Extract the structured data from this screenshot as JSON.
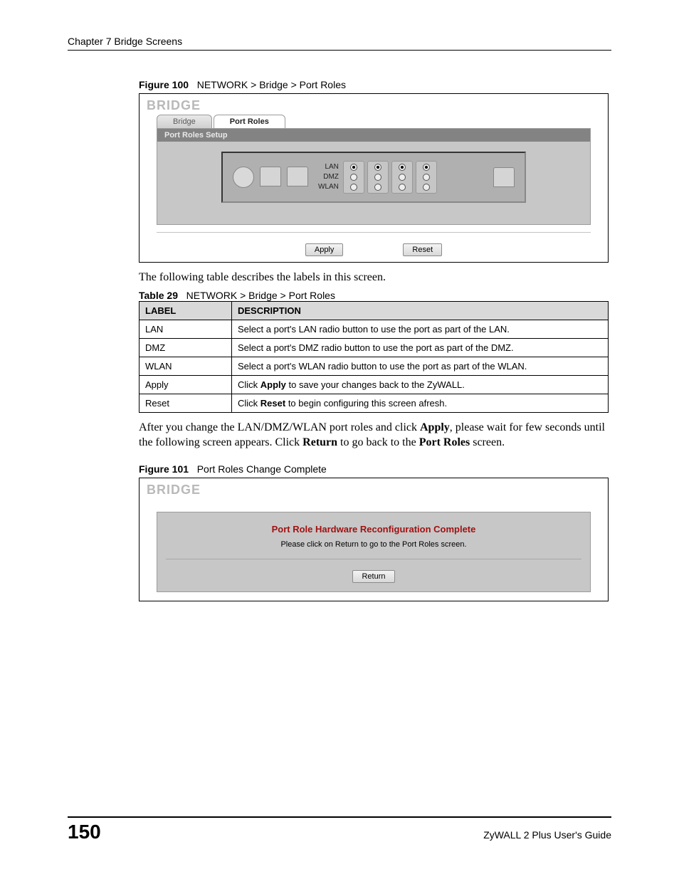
{
  "header": {
    "chapter": "Chapter 7 Bridge Screens"
  },
  "figure100": {
    "caption_label": "Figure 100",
    "caption_text": "NETWORK > Bridge > Port Roles",
    "title": "BRIDGE",
    "tabs": {
      "bridge": "Bridge",
      "port_roles": "Port Roles"
    },
    "panel_header": "Port Roles Setup",
    "role_labels": {
      "lan": "LAN",
      "dmz": "DMZ",
      "wlan": "WLAN"
    },
    "buttons": {
      "apply": "Apply",
      "reset": "Reset"
    }
  },
  "intro_text": "The following table describes the labels in this screen.",
  "table29": {
    "caption_label": "Table 29",
    "caption_text": "NETWORK > Bridge > Port Roles",
    "headers": {
      "label": "LABEL",
      "description": "DESCRIPTION"
    },
    "rows": [
      {
        "label": "LAN",
        "desc": "Select a port's LAN radio button to use the port as part of the LAN."
      },
      {
        "label": "DMZ",
        "desc": "Select a port's DMZ radio button to use the port as part of the DMZ."
      },
      {
        "label": "WLAN",
        "desc": "Select a port's WLAN radio button to use the port as part of the WLAN."
      },
      {
        "label": "Apply",
        "desc_pre": "Click ",
        "bold": "Apply",
        "desc_post": " to save your changes back to the ZyWALL."
      },
      {
        "label": "Reset",
        "desc_pre": "Click ",
        "bold": "Reset",
        "desc_post": " to begin configuring this screen afresh."
      }
    ]
  },
  "post_table_text": {
    "p1a": "After you change the LAN/DMZ/WLAN port roles and click ",
    "p1b": "Apply",
    "p1c": ", please wait for few seconds until the following screen appears. Click ",
    "p1d": "Return",
    "p1e": " to go back to the ",
    "p1f": "Port Roles",
    "p1g": " screen."
  },
  "figure101": {
    "caption_label": "Figure 101",
    "caption_text": "Port Roles Change Complete",
    "title": "BRIDGE",
    "heading": "Port Role Hardware Reconfiguration Complete",
    "sub": "Please click on Return to go to the Port Roles screen.",
    "button": "Return"
  },
  "footer": {
    "page": "150",
    "guide": "ZyWALL 2 Plus User's Guide"
  }
}
